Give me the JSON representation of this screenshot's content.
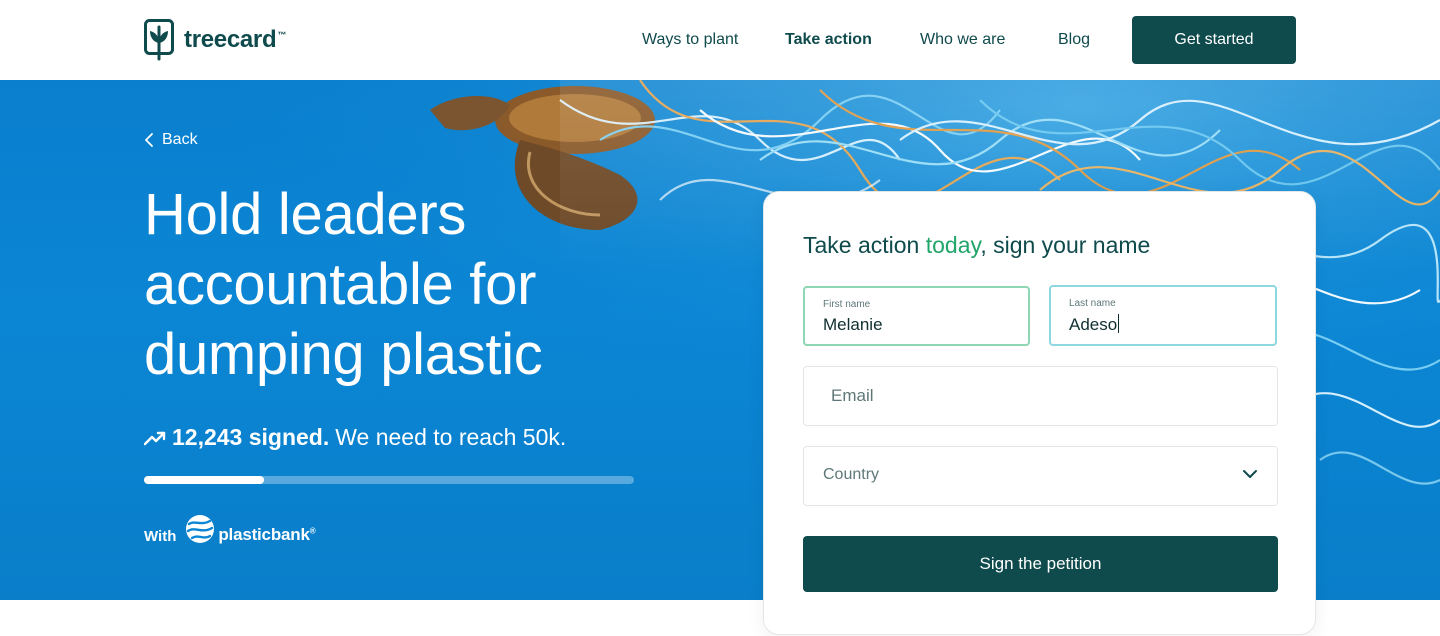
{
  "brand": {
    "name": "treecard",
    "trademark": "™",
    "logo_icon": "leaf-tree-icon",
    "color_primary": "#0f4a4c",
    "color_accent": "#21a66a",
    "color_hero": "#0b86d4"
  },
  "nav": {
    "items": [
      {
        "label": "Ways to plant",
        "active": false
      },
      {
        "label": "Take action",
        "active": true
      },
      {
        "label": "Who we are",
        "active": false
      },
      {
        "label": "Blog",
        "active": false
      }
    ],
    "cta_label": "Get started"
  },
  "hero": {
    "back_label": "Back",
    "back_icon": "chevron-left-icon",
    "title_lines": [
      "Hold leaders",
      "accountable for",
      "dumping plastic"
    ],
    "signed_icon": "trending-up-icon",
    "signed_count": "12,243 signed.",
    "signed_goal": "We need to reach 50k.",
    "progress": {
      "current": 12243,
      "goal": 50000
    },
    "partner_prefix": "With",
    "partner_name": "plasticbank",
    "partner_registered": "®",
    "partner_icon": "plasticbank-globe-icon"
  },
  "form": {
    "title_start": "Take action ",
    "title_accent": "today",
    "title_end": ", sign your name",
    "first_name": {
      "label": "First name",
      "value": "Melanie"
    },
    "last_name": {
      "label": "Last name",
      "value": "Adeso"
    },
    "email": {
      "placeholder": "Email"
    },
    "country": {
      "placeholder": "Country",
      "icon": "chevron-down-icon"
    },
    "submit_label": "Sign the petition"
  }
}
